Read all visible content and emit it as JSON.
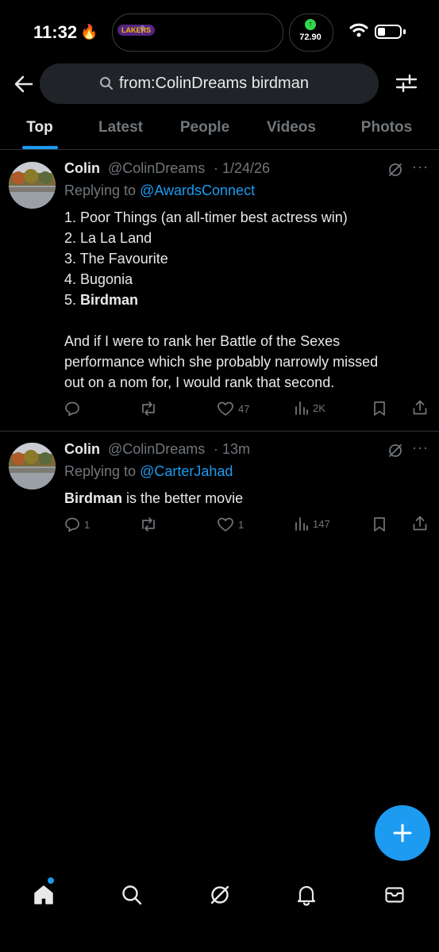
{
  "status": {
    "time": "11:32",
    "flame": "🔥",
    "stock_value": "72.90",
    "stock_arrow": "↑",
    "lakers": "LAKERS",
    "rockets": "⫯"
  },
  "search": {
    "query": "from:ColinDreams birdman"
  },
  "tabs": [
    {
      "label": "Top",
      "active": true
    },
    {
      "label": "Latest"
    },
    {
      "label": "People"
    },
    {
      "label": "Videos"
    },
    {
      "label": "Photos"
    }
  ],
  "tweets": [
    {
      "name": "Colin",
      "handle": "@ColinDreams",
      "time": "· 1/24/26",
      "replying_prefix": "Replying to ",
      "replying_to": "@AwardsConnect",
      "lines": [
        {
          "num": "1. ",
          "text": "Poor Things (an all-timer best actress win)"
        },
        {
          "num": "2. ",
          "text": "La La Land"
        },
        {
          "num": "3. ",
          "text": "The Favourite"
        },
        {
          "num": "4. ",
          "text": "Bugonia"
        },
        {
          "num": "5. ",
          "text": "Birdman"
        }
      ],
      "para": [
        "And if I were to rank her Battle of the Sexes",
        "performance which she probably narrowly missed",
        "out on a nom for, I would rank that second."
      ],
      "replies": "",
      "retweets": "",
      "likes": "47",
      "views": "2K"
    },
    {
      "name": "Colin",
      "handle": "@ColinDreams",
      "time": "· 13m",
      "replying_prefix": "Replying to ",
      "replying_to": "@CarterJahad",
      "bold": "Birdman",
      "rest": " is the better movie",
      "replies": "1",
      "retweets": "",
      "likes": "1",
      "views": "147"
    }
  ],
  "colors": {
    "accent": "#1d9bf0",
    "bg": "#000000",
    "muted": "#71767b",
    "text": "#e7e9ea"
  },
  "icons": [
    "back-arrow-icon",
    "search-icon",
    "filter-icon",
    "grok-icon",
    "more-icon",
    "reply-icon",
    "retweet-icon",
    "like-icon",
    "views-icon",
    "bookmark-icon",
    "share-icon",
    "compose-icon",
    "home-icon",
    "bell-icon",
    "mail-icon"
  ]
}
